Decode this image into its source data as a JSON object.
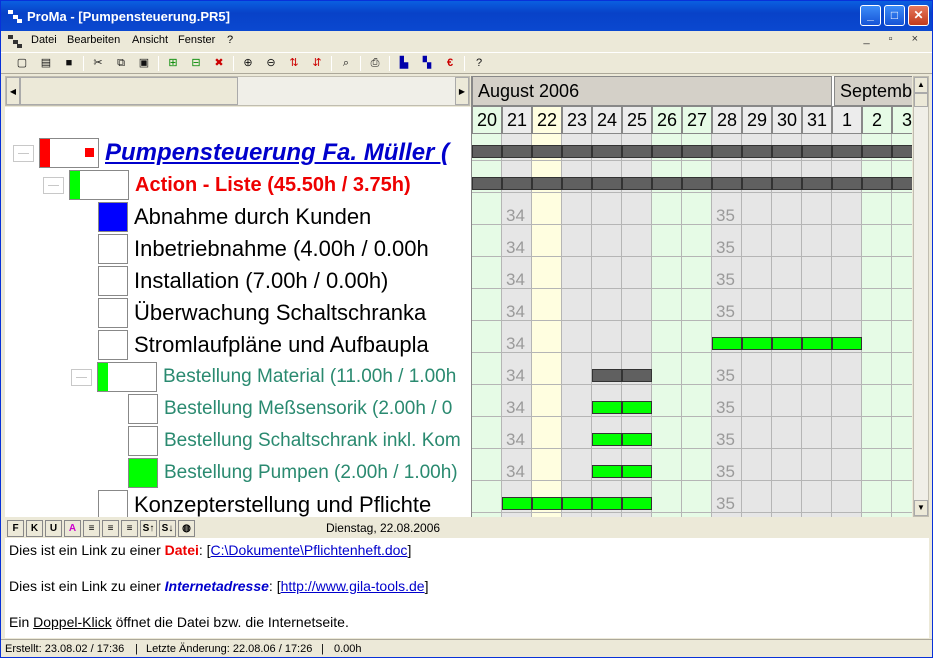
{
  "window": {
    "title": "ProMa - [Pumpensteuerung.PR5]",
    "min": "_",
    "max": "□",
    "close": "✕"
  },
  "menu": [
    {
      "label": "Datei"
    },
    {
      "label": "Bearbeiten"
    },
    {
      "label": "Ansicht"
    },
    {
      "label": "Fenster"
    },
    {
      "label": "?"
    }
  ],
  "mdi_controls": "_ ▫ ×",
  "toolbar": [
    "new-icon",
    "open-icon",
    "save-icon",
    "cut-icon",
    "copy-icon",
    "paste-icon",
    "insert-row-icon",
    "insert-sub-icon",
    "delete-icon",
    "zoom-in-icon",
    "zoom-out-icon",
    "sort-up-icon",
    "sort-down-icon",
    "search-icon",
    "print-icon",
    "export-icon",
    "export2-icon",
    "euro-icon",
    "help-icon"
  ],
  "tree": {
    "rows": [
      {
        "level": 0,
        "text": "Pumpensteuerung Fa. Müller (",
        "style": "project",
        "fill": "red-partial"
      },
      {
        "level": 1,
        "text": "Action - Liste (45.50h / 3.75h)",
        "style": "action",
        "fill": "green-partial"
      },
      {
        "level": 2,
        "text": "Abnahme durch Kunden",
        "style": "task",
        "fill": "blue-full"
      },
      {
        "level": 2,
        "text": "Inbetriebnahme (4.00h / 0.00h",
        "style": "task",
        "fill": "none"
      },
      {
        "level": 2,
        "text": "Installation (7.00h / 0.00h)",
        "style": "task",
        "fill": "none"
      },
      {
        "level": 2,
        "text": "Überwachung Schaltschranka",
        "style": "task",
        "fill": "none"
      },
      {
        "level": 2,
        "text": "Stromlaufpläne und Aufbaupla",
        "style": "task",
        "fill": "none"
      },
      {
        "level": 3,
        "text": "Bestellung Material (11.00h / 1.00h",
        "style": "group",
        "fill": "green-partial"
      },
      {
        "level": 4,
        "text": "Bestellung Meßsensorik (2.00h / 0",
        "style": "sub",
        "fill": "none"
      },
      {
        "level": 4,
        "text": "Bestellung Schaltschrank inkl. Kom",
        "style": "sub",
        "fill": "none"
      },
      {
        "level": 4,
        "text": "Bestellung Pumpen (2.00h / 1.00h)",
        "style": "sub",
        "fill": "green-full"
      },
      {
        "level": 2,
        "text": "Konzepterstellung und Pflichte",
        "style": "task",
        "fill": "none"
      }
    ]
  },
  "gantt": {
    "months": [
      {
        "label": "August 2006"
      },
      {
        "label": "Septemb"
      }
    ],
    "days": [
      "20",
      "21",
      "22",
      "23",
      "24",
      "25",
      "26",
      "27",
      "28",
      "29",
      "30",
      "31",
      "1",
      "2",
      "3"
    ],
    "week_labels": {
      "a": "34",
      "b": "35"
    },
    "highlight_color": "#fffee0",
    "weekend_color": "#e6fbe6",
    "bar_green": "#00ff00",
    "bar_gray": "#606060"
  },
  "format_buttons": [
    "F",
    "K",
    "U",
    "A",
    "≡",
    "≡",
    "≡",
    "S↑",
    "S↓",
    "◍"
  ],
  "date_status": "Dienstag, 22.08.2006",
  "notes": {
    "line1_prefix": "Dies ist ein Link zu einer ",
    "line1_kind": "Datei",
    "line1_mid": ": [",
    "line1_link": "C:\\Dokumente\\Pflichtenheft.doc",
    "line1_end": "]",
    "line2_prefix": "Dies ist ein Link zu einer ",
    "line2_kind": "Internetadresse",
    "line2_mid": ": [",
    "line2_link": "http://www.gila-tools.de",
    "line2_end": "]",
    "line3_prefix": "Ein ",
    "line3_link": "Doppel-Klick",
    "line3_end": " öffnet die Datei bzw. die Internetseite."
  },
  "status": {
    "created": "Erstellt: 23.08.02 / 17:36",
    "changed": "Letzte Änderung: 22.08.06 / 17:26",
    "hours": "0.00h"
  }
}
